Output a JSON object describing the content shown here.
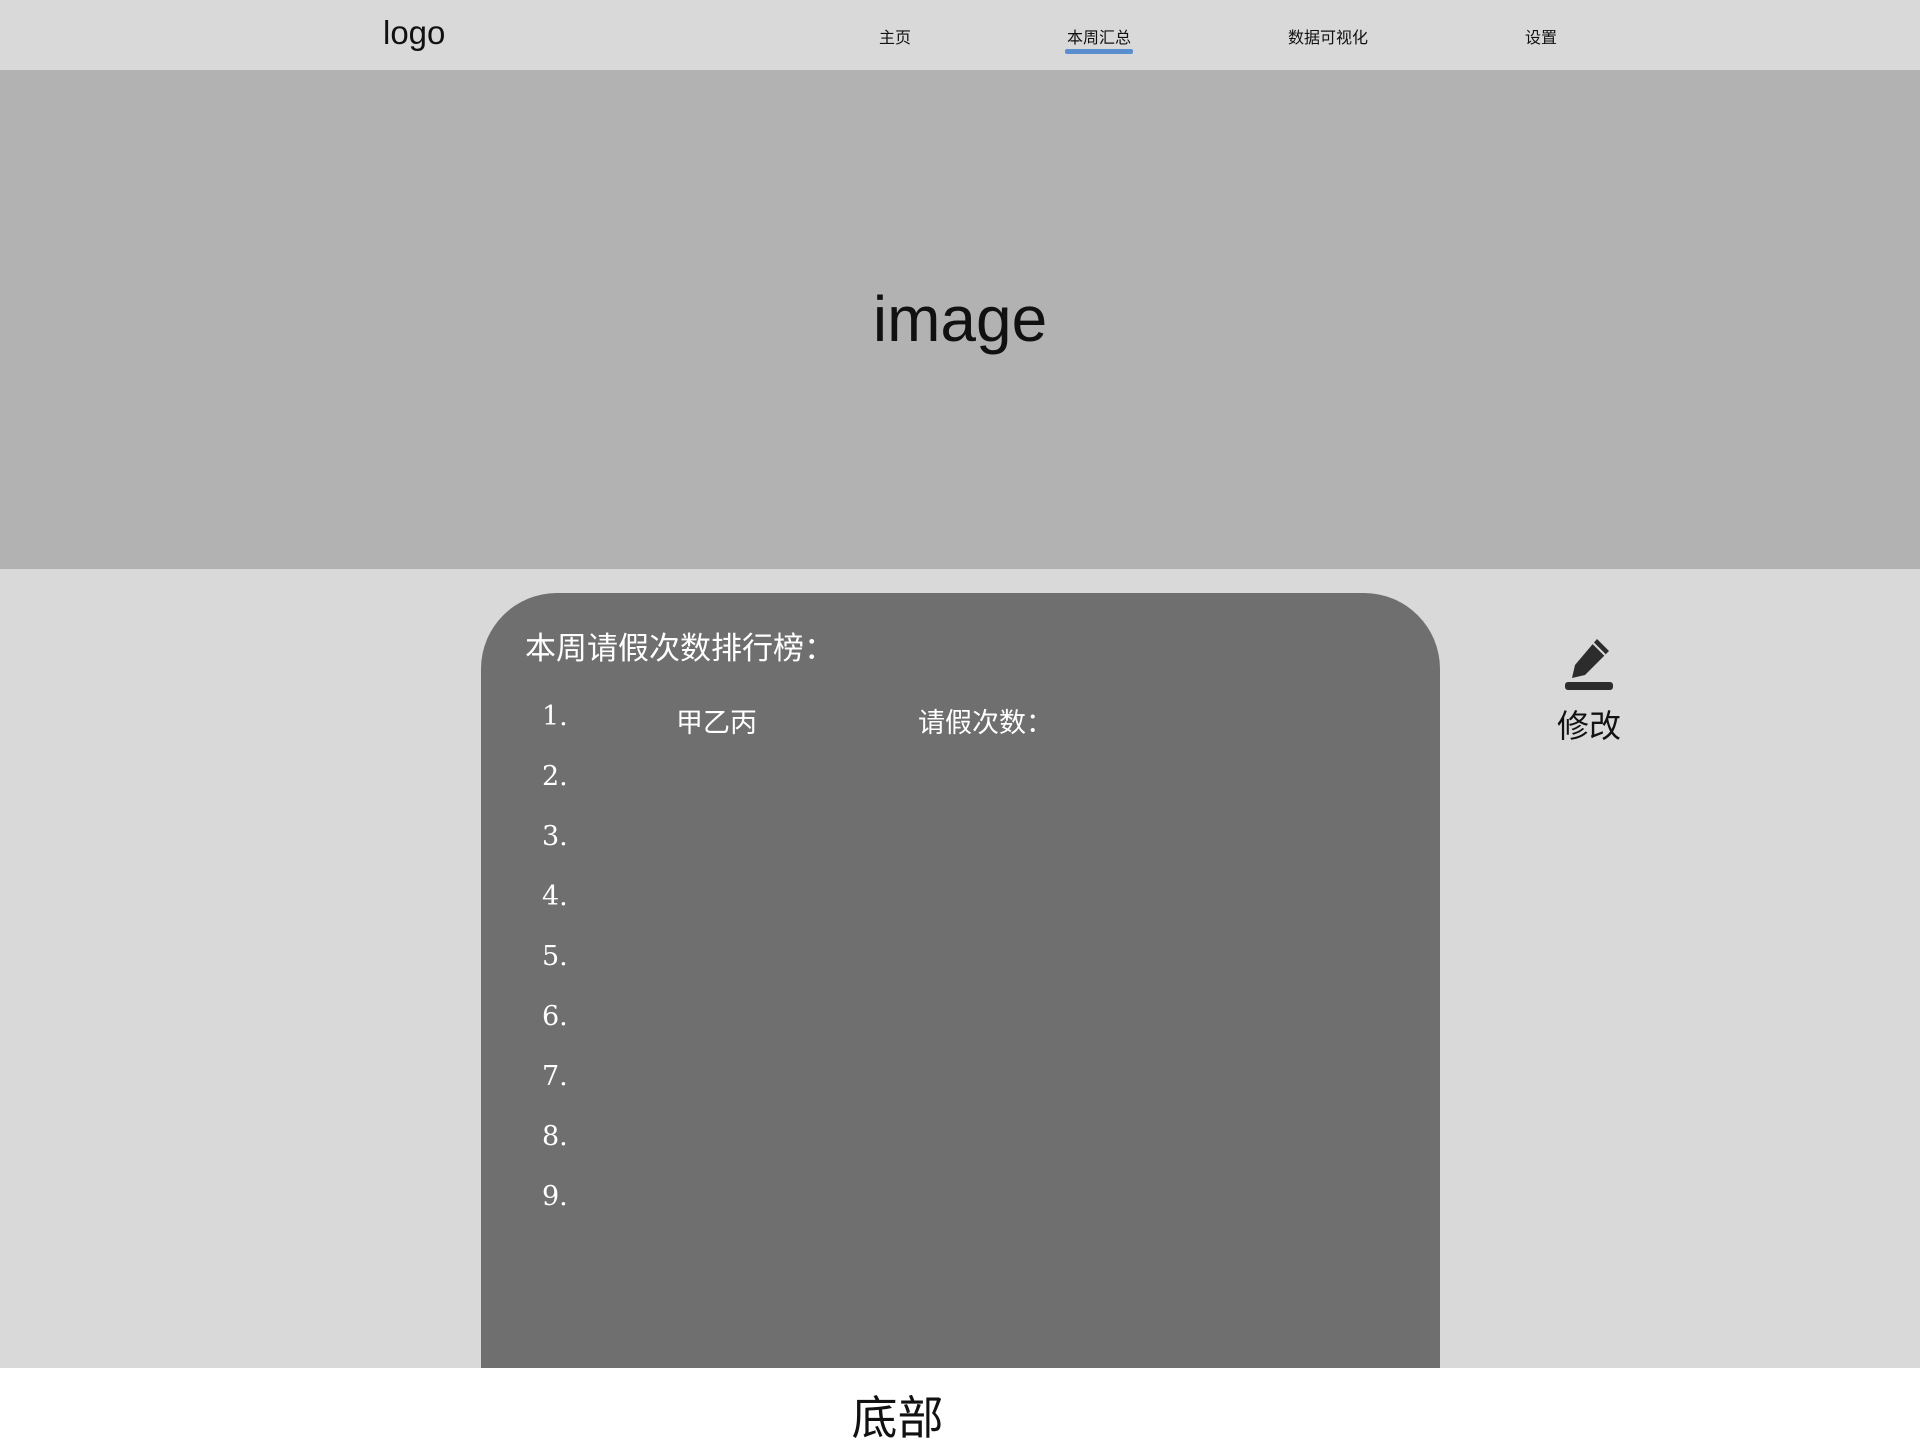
{
  "header": {
    "logo": "logo",
    "nav": [
      {
        "label": "主页",
        "active": false
      },
      {
        "label": "本周汇总",
        "active": true
      },
      {
        "label": "数据可视化",
        "active": false
      },
      {
        "label": "设置",
        "active": false
      }
    ]
  },
  "banner": {
    "text": "image"
  },
  "ranking": {
    "title": "本周请假次数排行榜：",
    "rows": [
      {
        "num": "1.",
        "name": "甲乙丙",
        "count_label": "请假次数："
      },
      {
        "num": "2.",
        "name": "",
        "count_label": ""
      },
      {
        "num": "3.",
        "name": "",
        "count_label": ""
      },
      {
        "num": "4.",
        "name": "",
        "count_label": ""
      },
      {
        "num": "5.",
        "name": "",
        "count_label": ""
      },
      {
        "num": "6.",
        "name": "",
        "count_label": ""
      },
      {
        "num": "7.",
        "name": "",
        "count_label": ""
      },
      {
        "num": "8.",
        "name": "",
        "count_label": ""
      },
      {
        "num": "9.",
        "name": "",
        "count_label": ""
      }
    ]
  },
  "edit": {
    "icon": "edit-icon",
    "label": "修改"
  },
  "footer": {
    "text": "底部"
  },
  "colors": {
    "header_bg": "#d9d9d9",
    "banner_bg": "#b2b2b2",
    "card_bg": "#6f6f6f",
    "accent": "#5b8ecf"
  }
}
